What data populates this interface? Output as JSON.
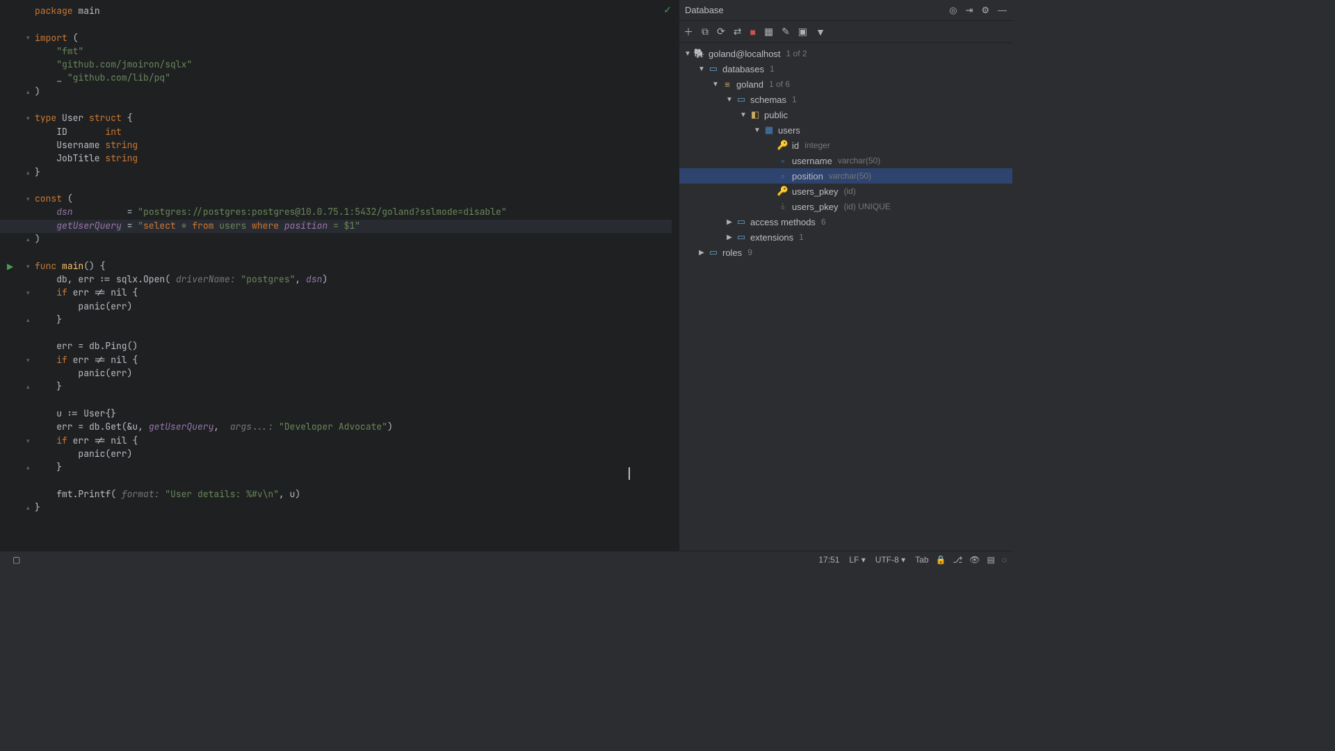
{
  "editor": {
    "package_kw": "package",
    "package_name": "main",
    "import_kw": "import",
    "imp1": "\"fmt\"",
    "imp2": "\"github.com/jmoiron/sqlx\"",
    "imp3_blank": "_",
    "imp3": "\"github.com/lib/pq\"",
    "type_kw": "type",
    "user": "User",
    "struct_kw": "struct",
    "field_id": "ID",
    "field_id_t": "int",
    "field_un": "Username",
    "field_un_t": "string",
    "field_jt": "JobTitle",
    "field_jt_t": "string",
    "const_kw": "const",
    "dsn_name": "dsn",
    "dsn_val": "\"postgres://postgres:postgres@10.0.75.1:5432/goland?sslmode=disable\"",
    "guq_name": "getUserQuery",
    "sql_open": "\"",
    "sql_select": "select",
    "sql_star": " * ",
    "sql_from": "from",
    "sql_users": " users ",
    "sql_where": "where",
    "sql_pos": " position",
    "sql_rest": " = $1\"",
    "func_kw": "func",
    "main_fn": "main",
    "db_line": "db, err := sqlx.Open(",
    "hint_drv": " driverName: ",
    "pg_str": "\"postgres\"",
    "comma": ", ",
    "dsn_ref": "dsn",
    "close_paren": ")",
    "if_kw": "if",
    "err_nil": " err != nil {",
    "panic": "panic(err)",
    "brace_close": "}",
    "ping": "err = db.Ping()",
    "u_init": "u := User{}",
    "get_line": "err = db.Get(&u, ",
    "guq_ref": "getUserQuery",
    "hint_args": "  args...: ",
    "dev_adv": "\"Developer Advocate\"",
    "printf_open": "fmt.Printf(",
    "hint_fmt": " format: ",
    "printf_str": "\"User details: %#v\\n\"",
    "printf_rest": ", u)"
  },
  "database": {
    "title": "Database",
    "tree": {
      "ds": {
        "name": "goland@localhost",
        "meta": "1 of 2"
      },
      "dbs": {
        "name": "databases",
        "meta": "1"
      },
      "goland": {
        "name": "goland",
        "meta": "1 of 6"
      },
      "schemas": {
        "name": "schemas",
        "meta": "1"
      },
      "public": {
        "name": "public"
      },
      "users": {
        "name": "users"
      },
      "col_id": {
        "name": "id",
        "type": "integer"
      },
      "col_un": {
        "name": "username",
        "type": "varchar(50)"
      },
      "col_pos": {
        "name": "position",
        "type": "varchar(50)"
      },
      "pkey1": {
        "name": "users_pkey",
        "meta": "(id)"
      },
      "pkey2": {
        "name": "users_pkey",
        "meta": "(id) UNIQUE"
      },
      "access": {
        "name": "access methods",
        "meta": "6"
      },
      "ext": {
        "name": "extensions",
        "meta": "1"
      },
      "roles": {
        "name": "roles",
        "meta": "9"
      }
    }
  },
  "status": {
    "time": "17:51",
    "line_sep": "LF",
    "encoding": "UTF-8",
    "indent": "Tab"
  }
}
